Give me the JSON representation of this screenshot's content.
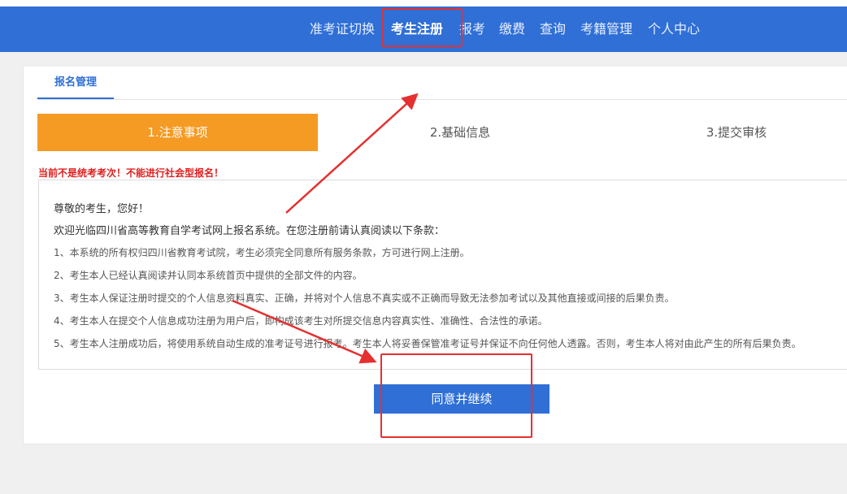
{
  "nav": {
    "items": [
      {
        "label": "准考证切换"
      },
      {
        "label": "考生注册"
      },
      {
        "label": "报考"
      },
      {
        "label": "缴费"
      },
      {
        "label": "查询"
      },
      {
        "label": "考籍管理"
      },
      {
        "label": "个人中心"
      }
    ],
    "active_index": 1
  },
  "tabs": [
    {
      "label": "报名管理"
    }
  ],
  "steps": [
    {
      "label": "1.注意事项"
    },
    {
      "label": "2.基础信息"
    },
    {
      "label": "3.提交审核"
    }
  ],
  "warning": "当前不是统考考次！不能进行社会型报名！",
  "notice": {
    "greeting": "尊敬的考生，您好！",
    "intro": "欢迎光临四川省高等教育自学考试网上报名系统。在您注册前请认真阅读以下条款：",
    "terms": [
      "1、本系统的所有权归四川省教育考试院，考生必须完全同意所有服务条款，方可进行网上注册。",
      "2、考生本人已经认真阅读并认同本系统首页中提供的全部文件的内容。",
      "3、考生本人保证注册时提交的个人信息资料真实、正确，并将对个人信息不真实或不正确而导致无法参加考试以及其他直接或间接的后果负责。",
      "4、考生本人在提交个人信息成功注册为用户后，即构成该考生对所提交信息内容真实性、准确性、合法性的承诺。",
      "5、考生本人注册成功后，将使用系统自动生成的准考证号进行报考。考生本人将妥善保管准考证号并保证不向任何他人透露。否则，考生本人将对由此产生的所有后果负责。"
    ]
  },
  "agree_button": "同意并继续",
  "colors": {
    "nav_bg": "#2f6fd6",
    "step_active": "#f59a23",
    "button": "#2f6fd6",
    "annotation": "#e53030",
    "warning": "#e02020"
  }
}
